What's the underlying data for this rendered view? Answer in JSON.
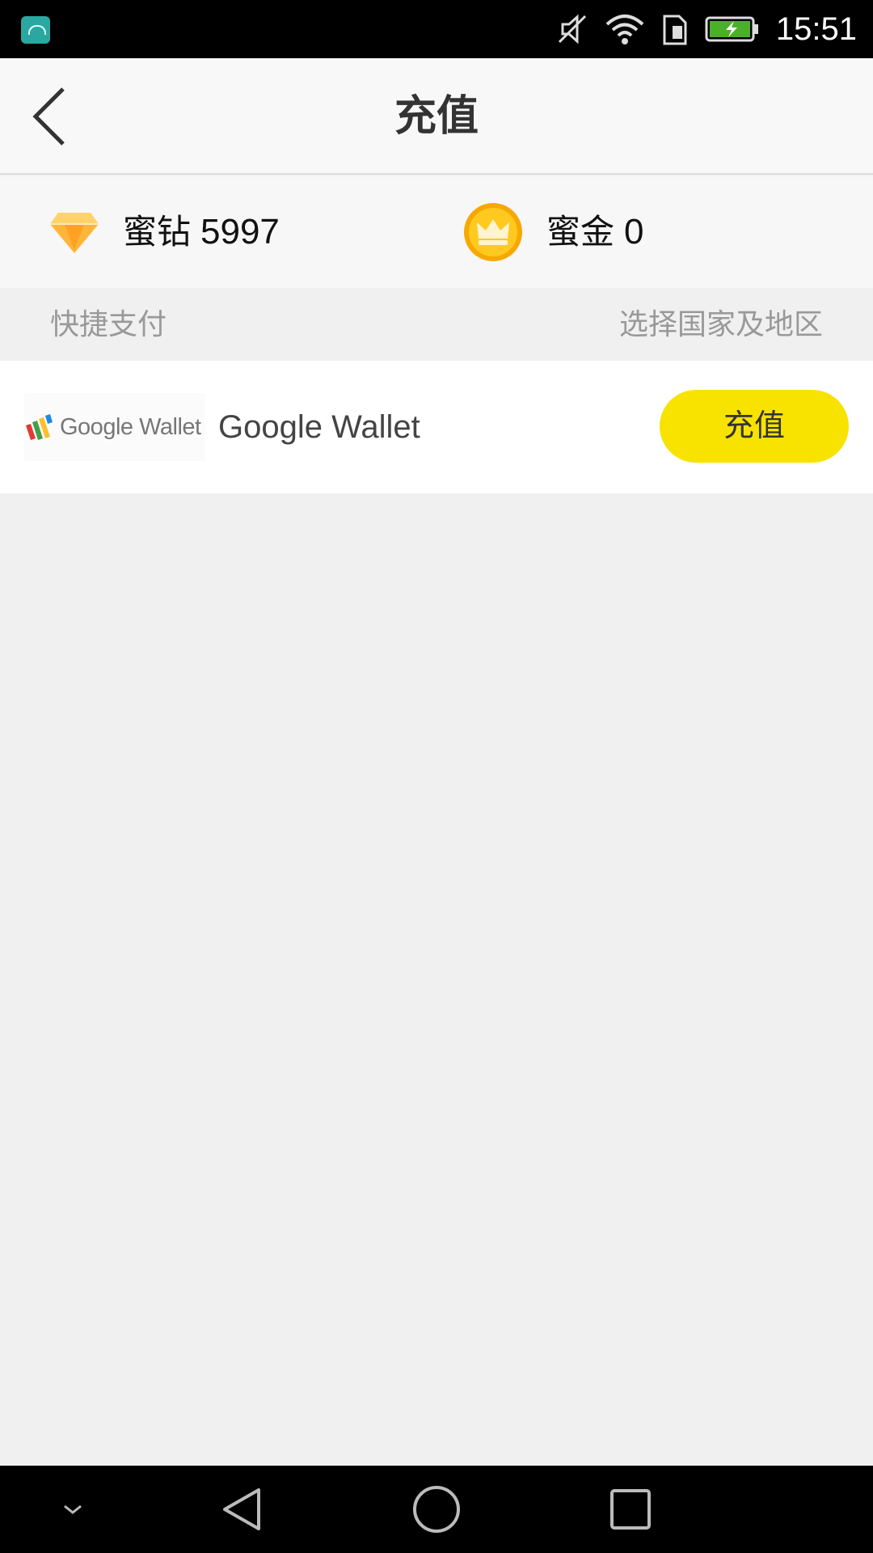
{
  "status_bar": {
    "time": "15:51",
    "icons": [
      "android-notification-icon",
      "mute-icon",
      "wifi-icon",
      "sim-icon",
      "battery-charging-icon"
    ]
  },
  "header": {
    "title": "充值",
    "back_icon": "chevron-left-icon"
  },
  "balances": [
    {
      "icon": "diamond-icon",
      "label": "蜜钻",
      "value": "5997"
    },
    {
      "icon": "crown-coin-icon",
      "label": "蜜金",
      "value": "0"
    }
  ],
  "section": {
    "title": "快捷支付",
    "region_link": "选择国家及地区"
  },
  "payment_methods": [
    {
      "logo_text": "Google Wallet",
      "name": "Google Wallet",
      "button_label": "充值"
    }
  ],
  "colors": {
    "accent_button": "#f8e200",
    "background": "#f0f0f0"
  },
  "nav_bar": {
    "icons": [
      "collapse-icon",
      "back-triangle-icon",
      "home-circle-icon",
      "recents-square-icon"
    ]
  }
}
